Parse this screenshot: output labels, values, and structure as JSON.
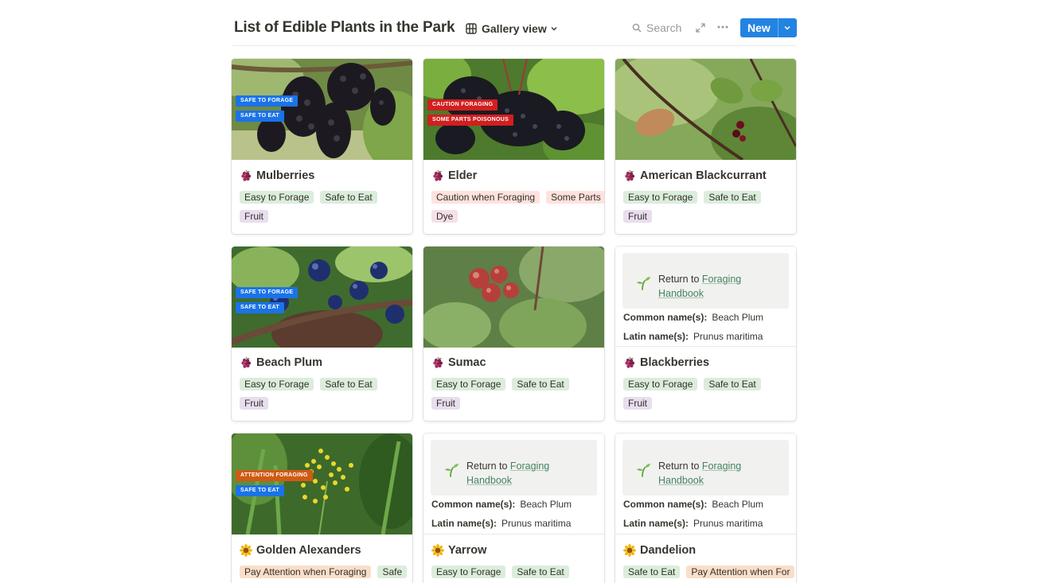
{
  "header": {
    "title": "List of Edible Plants in the Park",
    "view_label": "Gallery view",
    "search_label": "Search",
    "new_label": "New",
    "accent_color": "#2383e2"
  },
  "callout": {
    "return_text": "Return to",
    "link_line1": "Foraging",
    "link_line2": "Handbook",
    "common_label": "Common name(s):",
    "common_value": "Beach Plum",
    "latin_label": "Latin name(s):",
    "latin_value": "Prunus maritima"
  },
  "cards": [
    {
      "title": "Mulberries",
      "icon": "grapes-icon",
      "cover": "photo",
      "badges": [
        "SAFE TO FORAGE",
        "SAFE TO EAT"
      ],
      "tags": [
        [
          "Easy to Forage",
          "Safe to Eat"
        ],
        [
          "Fruit"
        ]
      ]
    },
    {
      "title": "Elder",
      "icon": "grapes-icon",
      "cover": "photo",
      "badges": [
        "CAUTION FORAGING",
        "SOME PARTS POISONOUS"
      ],
      "tags": [
        [
          "Caution when Foraging",
          "Some Parts"
        ],
        [
          "Dye"
        ]
      ]
    },
    {
      "title": "American Blackcurrant",
      "icon": "grapes-icon",
      "cover": "photo",
      "badges": [],
      "tags": [
        [
          "Easy to Forage",
          "Safe to Eat"
        ],
        [
          "Fruit"
        ]
      ]
    },
    {
      "title": "Beach Plum",
      "icon": "grapes-icon",
      "cover": "photo",
      "badges": [
        "SAFE TO FORAGE",
        "SAFE TO EAT"
      ],
      "tags": [
        [
          "Easy to Forage",
          "Safe to Eat"
        ],
        [
          "Fruit"
        ]
      ]
    },
    {
      "title": "Sumac",
      "icon": "grapes-icon",
      "cover": "photo",
      "badges": [],
      "tags": [
        [
          "Easy to Forage",
          "Safe to Eat"
        ],
        [
          "Fruit"
        ]
      ]
    },
    {
      "title": "Blackberries",
      "icon": "grapes-icon",
      "cover": "page-preview",
      "badges": [],
      "tags": [
        [
          "Easy to Forage",
          "Safe to Eat"
        ],
        [
          "Fruit"
        ]
      ]
    },
    {
      "title": "Golden Alexanders",
      "icon": "sunflower-icon",
      "cover": "photo",
      "badges": [
        "ATTENTION FORAGING",
        "SAFE TO EAT"
      ],
      "tags": [
        [
          "Pay Attention when Foraging",
          "Safe"
        ]
      ]
    },
    {
      "title": "Yarrow",
      "icon": "sunflower-icon",
      "cover": "page-preview",
      "badges": [],
      "tags": [
        [
          "Easy to Forage",
          "Safe to Eat"
        ]
      ]
    },
    {
      "title": "Dandelion",
      "icon": "sunflower-icon",
      "cover": "page-preview",
      "badges": [],
      "tags": [
        [
          "Safe to Eat",
          "Pay Attention when For"
        ]
      ]
    }
  ]
}
